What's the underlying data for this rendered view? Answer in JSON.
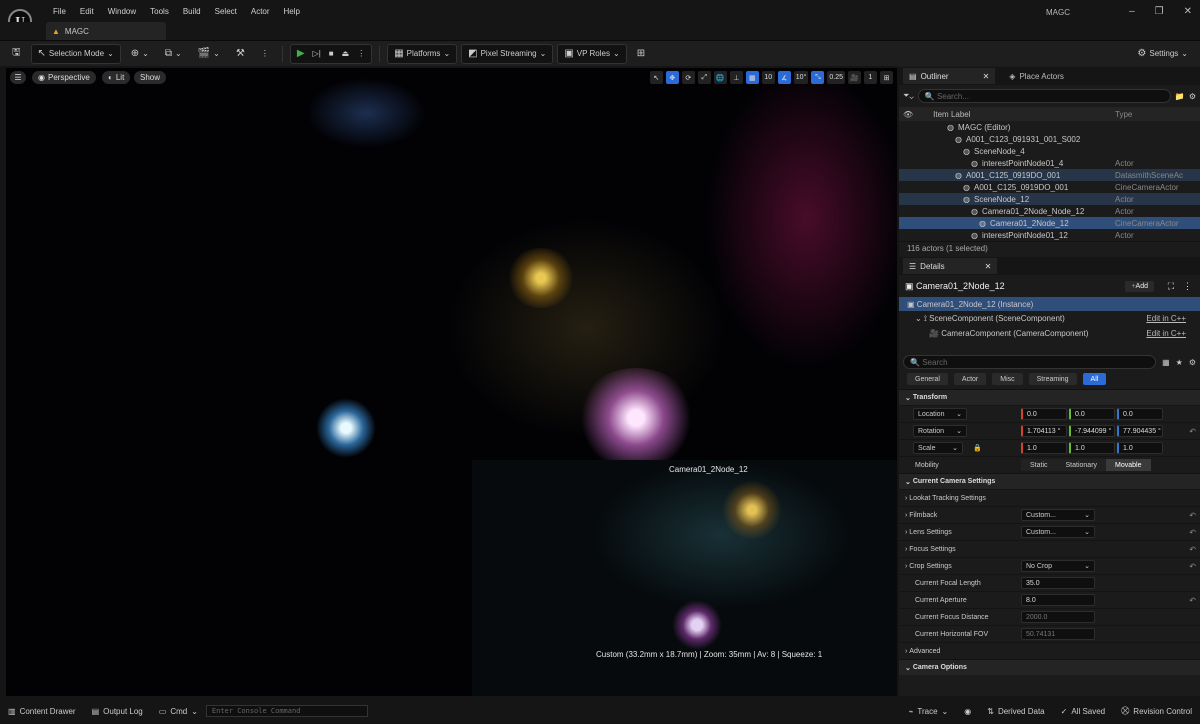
{
  "menubar": {
    "logo": "U",
    "items": [
      "File",
      "Edit",
      "Window",
      "Tools",
      "Build",
      "Select",
      "Actor",
      "Help"
    ],
    "project": "MAGC"
  },
  "tab": {
    "label": "MAGC"
  },
  "toolbar": {
    "selection_mode": "Selection Mode",
    "platforms": "Platforms",
    "pixel_streaming": "Pixel Streaming",
    "vp_roles": "VP Roles",
    "settings": "Settings"
  },
  "viewport": {
    "perspective": "Perspective",
    "lit": "Lit",
    "show": "Show",
    "grid_value": "10",
    "angle_value": "10°",
    "scale_value": "0.25",
    "camera_speed": "1",
    "pip_caption": "Camera01_2Node_12",
    "camera_info": "Custom (33.2mm x 18.7mm) | Zoom: 35mm | Av: 8 | Squeeze: 1"
  },
  "outliner": {
    "tab": "Outliner",
    "tab2": "Place Actors",
    "search_placeholder": "Search...",
    "col_label": "Item Label",
    "col_type": "Type",
    "rows": [
      {
        "label": "MAGC (Editor)",
        "type": "",
        "indent": 44,
        "cls": ""
      },
      {
        "label": "A001_C123_091931_001_S002",
        "type": "",
        "indent": 52,
        "cls": ""
      },
      {
        "label": "SceneNode_4",
        "type": "",
        "indent": 60,
        "cls": ""
      },
      {
        "label": "interestPointNode01_4",
        "type": "Actor",
        "indent": 68,
        "cls": ""
      },
      {
        "label": "A001_C125_0919DO_001",
        "type": "DatasmithSceneAc",
        "indent": 52,
        "cls": "hl"
      },
      {
        "label": "A001_C125_0919DO_001",
        "type": "CineCameraActor",
        "indent": 60,
        "cls": ""
      },
      {
        "label": "SceneNode_12",
        "type": "Actor",
        "indent": 60,
        "cls": "hl"
      },
      {
        "label": "Camera01_2Node_Node_12",
        "type": "Actor",
        "indent": 68,
        "cls": ""
      },
      {
        "label": "Camera01_2Node_12",
        "type": "CineCameraActor",
        "indent": 76,
        "cls": "sel"
      },
      {
        "label": "interestPointNode01_12",
        "type": "Actor",
        "indent": 68,
        "cls": ""
      }
    ],
    "count": "116 actors (1 selected)"
  },
  "details": {
    "tab": "Details",
    "object_name": "Camera01_2Node_12",
    "add": "Add",
    "instance": "Camera01_2Node_12 (Instance)",
    "components": [
      {
        "label": "SceneComponent (SceneComponent)",
        "link": "Edit in C++"
      },
      {
        "label": "CameraComponent (CameraComponent)",
        "link": "Edit in C++"
      }
    ],
    "search_placeholder": "Search",
    "filters": [
      "General",
      "Actor",
      "Misc",
      "Streaming",
      "All"
    ],
    "transform": {
      "title": "Transform",
      "location": {
        "label": "Location",
        "x": "0.0",
        "y": "0.0",
        "z": "0.0"
      },
      "rotation": {
        "label": "Rotation",
        "x": "1.704113 °",
        "y": "-7.944099 °",
        "z": "77.904435 °"
      },
      "scale": {
        "label": "Scale",
        "x": "1.0",
        "y": "1.0",
        "z": "1.0"
      },
      "mobility": {
        "label": "Mobility",
        "options": [
          "Static",
          "Stationary",
          "Movable"
        ]
      }
    },
    "camera": {
      "title": "Current Camera Settings",
      "lookat": "Lookat Tracking Settings",
      "filmback": {
        "label": "Filmback",
        "value": "Custom..."
      },
      "lens": {
        "label": "Lens Settings",
        "value": "Custom..."
      },
      "focus": "Focus Settings",
      "crop": {
        "label": "Crop Settings",
        "value": "No Crop"
      },
      "focal_length": {
        "label": "Current Focal Length",
        "value": "35.0"
      },
      "aperture": {
        "label": "Current Aperture",
        "value": "8.0"
      },
      "focus_distance": {
        "label": "Current Focus Distance",
        "value": "2000.0"
      },
      "hfov": {
        "label": "Current Horizontal FOV",
        "value": "50.74131"
      },
      "advanced": "Advanced"
    },
    "camera_options": "Camera Options"
  },
  "statusbar": {
    "content_drawer": "Content Drawer",
    "output_log": "Output Log",
    "cmd": "Cmd",
    "console_placeholder": "Enter Console Command",
    "trace": "Trace",
    "derived_data": "Derived Data",
    "all_saved": "All Saved",
    "revision_control": "Revision Control"
  }
}
